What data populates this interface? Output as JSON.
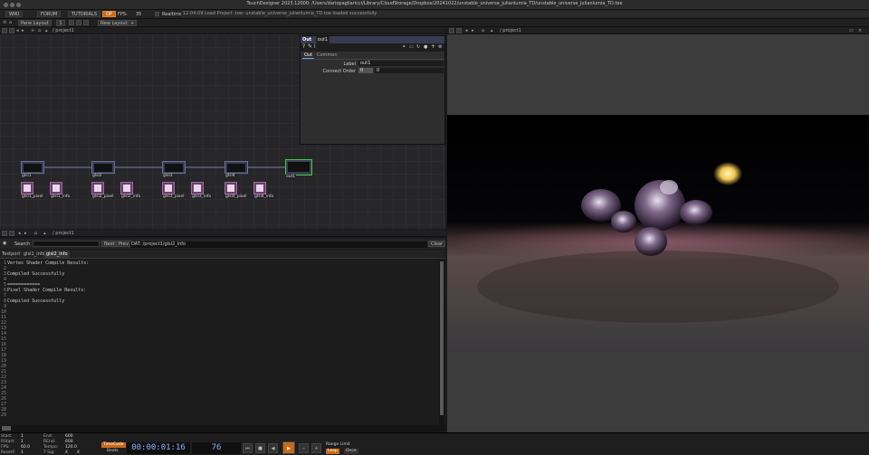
{
  "window": {
    "title": "TouchDesigner 2023.12000: /Users/dariopagliaricci/Library/CloudStorage/Dropbox/20241022/unstable_universe_julianlumia_TD/unstable_universe_julianlumia_TD.toe"
  },
  "menubar": {
    "items": [
      "WIKI",
      "FORUM",
      "TUTORIALS"
    ],
    "op_badge": "OP",
    "fps_label": "FPS:",
    "fps_value": "35",
    "realtime": "Realtime",
    "status": "12:04:09 Load Project .toe: unstable_universe_julianlumia_TD.toe loaded successfully"
  },
  "layout": {
    "pane_layout": "Pane Layout",
    "pane_count": "1",
    "new_layout": "New Layout",
    "plus": "+"
  },
  "network": {
    "path": "/ project1",
    "nodes": [
      {
        "name": "glsl1"
      },
      {
        "name": "glsl2"
      },
      {
        "name": "glsl3"
      },
      {
        "name": "glsl4"
      },
      {
        "name": "out1"
      }
    ],
    "dats": [
      {
        "name": "glsl1_pixel"
      },
      {
        "name": "glsl1_info"
      },
      {
        "name": "glsl2_pixel"
      },
      {
        "name": "glsl2_info"
      },
      {
        "name": "glsl3_pixel"
      },
      {
        "name": "glsl3_info"
      },
      {
        "name": "glsl4_pixel"
      },
      {
        "name": "glsl4_info"
      }
    ]
  },
  "params": {
    "type": "Out",
    "name": "out1",
    "tabs": [
      "Out",
      "Common"
    ],
    "label_label": "Label",
    "label_value": "out1",
    "connect_label": "Connect Order",
    "connect_value": "0",
    "connect_value2": "0"
  },
  "viewer": {
    "path": "/ project1"
  },
  "textport_pane": {
    "path": "/ project1",
    "search_label": "Search",
    "next": "Next",
    "prev": "Prev",
    "dat_path": "DAT: /project1/glsl2_info",
    "clear": "Clear",
    "tabs": [
      "Textport",
      "glsl1_info",
      "glsl2_info"
    ],
    "lines": [
      {
        "n": "1",
        "t": "Vertex Shader Compile Results:"
      },
      {
        "n": "2",
        "t": ""
      },
      {
        "n": "3",
        "t": "Compiled Successfully"
      },
      {
        "n": "4",
        "t": ""
      },
      {
        "n": "5",
        "t": "============"
      },
      {
        "n": "6",
        "t": "Pixel Shader Compile Results:"
      },
      {
        "n": "7",
        "t": ""
      },
      {
        "n": "8",
        "t": "Compiled Successfully"
      },
      {
        "n": "9",
        "t": ""
      },
      {
        "n": "10",
        "t": ""
      },
      {
        "n": "11",
        "t": ""
      },
      {
        "n": "12",
        "t": ""
      },
      {
        "n": "13",
        "t": ""
      },
      {
        "n": "14",
        "t": ""
      },
      {
        "n": "15",
        "t": ""
      },
      {
        "n": "16",
        "t": ""
      },
      {
        "n": "17",
        "t": ""
      },
      {
        "n": "18",
        "t": ""
      },
      {
        "n": "19",
        "t": ""
      },
      {
        "n": "20",
        "t": ""
      },
      {
        "n": "21",
        "t": ""
      },
      {
        "n": "22",
        "t": ""
      },
      {
        "n": "23",
        "t": ""
      },
      {
        "n": "24",
        "t": ""
      },
      {
        "n": "25",
        "t": ""
      },
      {
        "n": "26",
        "t": ""
      },
      {
        "n": "27",
        "t": ""
      },
      {
        "n": "28",
        "t": ""
      },
      {
        "n": "29",
        "t": ""
      }
    ]
  },
  "timeline": {
    "start_label": "Start:",
    "start": "1",
    "end_label": "End:",
    "end": "600",
    "rstart_label": "RStart:",
    "rstart": "1",
    "rend_label": "REnd:",
    "rend": "600",
    "fps_label": "FPS:",
    "fps": "60.0",
    "tempo_label": "Tempo:",
    "tempo": "120.0",
    "reset_label": "ResetF:",
    "reset": "1",
    "tsig_label": "T Sig:",
    "tsig1": "4",
    "tsig2": "4",
    "timecode": "TimeCode",
    "beats": "Beats",
    "time": "00:00:01:16",
    "frame": "76",
    "range_limit": "Range Limit",
    "loop": "Loop",
    "once": "Once",
    "ticks": [
      "1",
      "61",
      "121",
      "181",
      "241",
      "301",
      "361",
      "421",
      "481",
      "541",
      "600"
    ]
  }
}
